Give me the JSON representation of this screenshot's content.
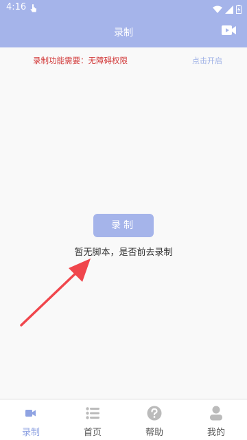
{
  "status_bar": {
    "time": "4:16"
  },
  "header": {
    "title": "录制",
    "video_icon": "video-camera-icon"
  },
  "notice": {
    "text": "录制功能需要：无障碍权限",
    "link": "点击开启"
  },
  "main": {
    "record_button_label": "录制",
    "empty_text": "暂无脚本，是否前去录制"
  },
  "bottom_nav": {
    "items": [
      {
        "label": "录制",
        "icon": "video-camera-icon",
        "active": true
      },
      {
        "label": "首页",
        "icon": "list-icon",
        "active": false
      },
      {
        "label": "帮助",
        "icon": "help-circle-icon",
        "active": false
      },
      {
        "label": "我的",
        "icon": "user-icon",
        "active": false
      }
    ]
  },
  "colors": {
    "primary": "#a5b4ea",
    "notice_red": "#d23a3a",
    "link_blue": "#9fb1e6",
    "arrow_red": "#f0464c",
    "nav_active": "#8fa3e2",
    "nav_inactive": "#bbbbbb"
  }
}
